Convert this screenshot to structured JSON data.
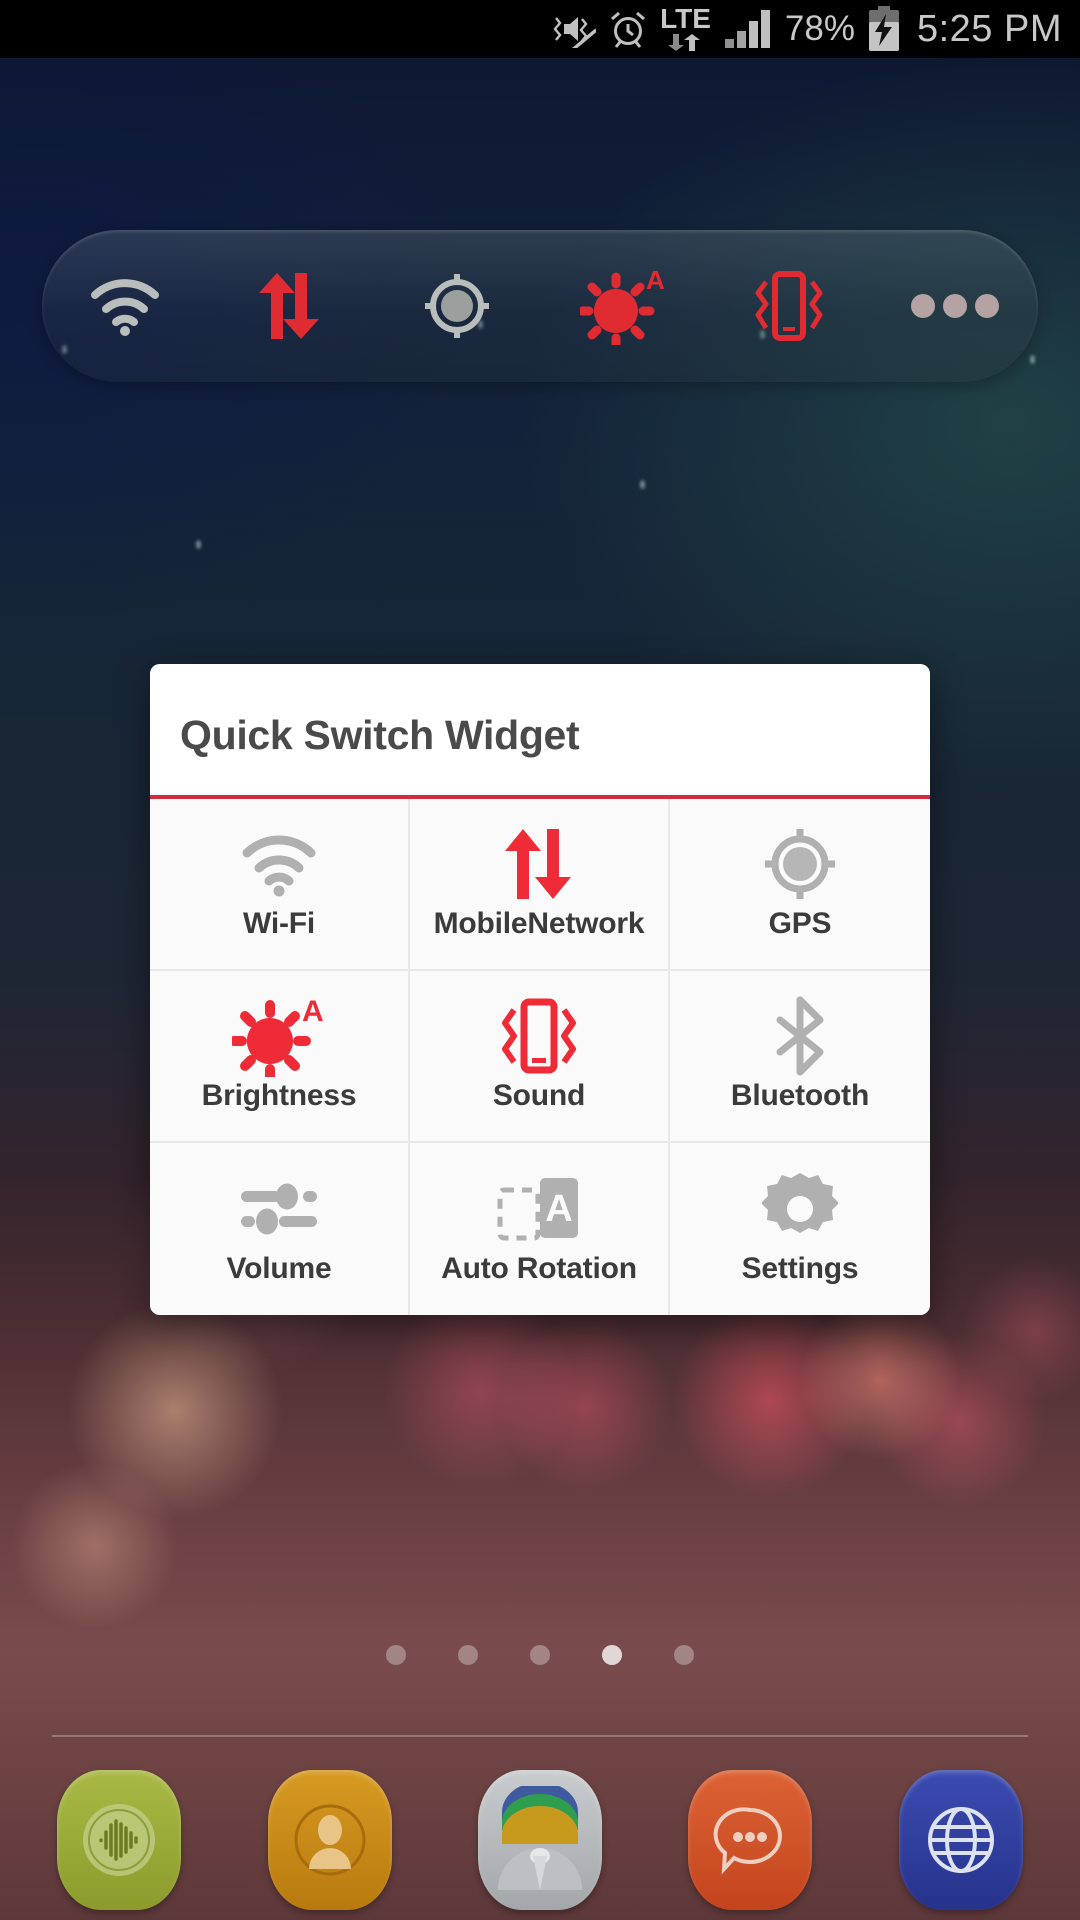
{
  "status_bar": {
    "time": "5:25 PM",
    "battery_percent": "78%",
    "network_type": "LTE",
    "icons": [
      "vibrate-mute-icon",
      "alarm-clock-icon",
      "lte-data-icon",
      "signal-bars-icon",
      "battery-charging-icon"
    ]
  },
  "floating_toolbar": {
    "items": [
      {
        "name": "wifi",
        "icon": "wifi-icon",
        "state": "off",
        "color": "#b9bdbc"
      },
      {
        "name": "mobile-network",
        "icon": "data-arrows-icon",
        "state": "on",
        "color": "#e02b33"
      },
      {
        "name": "gps",
        "icon": "gps-crosshair-icon",
        "state": "off",
        "color": "#b9bdbc"
      },
      {
        "name": "brightness",
        "icon": "brightness-auto-icon",
        "state": "on",
        "color": "#e02b33"
      },
      {
        "name": "sound",
        "icon": "vibrate-phone-icon",
        "state": "on",
        "color": "#e02b33"
      },
      {
        "name": "more",
        "icon": "more-dots-icon",
        "state": "off",
        "color": "#b9a5a5"
      }
    ]
  },
  "dialog": {
    "title": "Quick Switch Widget",
    "accent_color": "#d32b3c",
    "inactive_color": "#b0b0b0",
    "tiles": [
      {
        "label": "Wi-Fi",
        "icon": "wifi-icon",
        "state": "off",
        "color": "#b0b0b0"
      },
      {
        "label": "MobileNetwork",
        "icon": "data-arrows-icon",
        "state": "on",
        "color": "#ef2b38"
      },
      {
        "label": "GPS",
        "icon": "gps-crosshair-icon",
        "state": "off",
        "color": "#b0b0b0"
      },
      {
        "label": "Brightness",
        "icon": "brightness-auto-icon",
        "state": "on",
        "color": "#ef2b38"
      },
      {
        "label": "Sound",
        "icon": "vibrate-phone-icon",
        "state": "on",
        "color": "#ef2b38"
      },
      {
        "label": "Bluetooth",
        "icon": "bluetooth-icon",
        "state": "off",
        "color": "#b0b0b0"
      },
      {
        "label": "Volume",
        "icon": "volume-sliders-icon",
        "state": "off",
        "color": "#b0b0b0"
      },
      {
        "label": "Auto Rotation",
        "icon": "auto-rotation-icon",
        "state": "off",
        "color": "#b0b0b0"
      },
      {
        "label": "Settings",
        "icon": "gear-icon",
        "state": "off",
        "color": "#b0b0b0"
      }
    ]
  },
  "home_screen": {
    "page_dots": {
      "count": 5,
      "active_index": 3
    },
    "dock": [
      {
        "name": "phone-dialer",
        "icon": "soundwave-icon",
        "color": "#9aab3c"
      },
      {
        "name": "contacts",
        "icon": "person-icon",
        "color": "#c98a18"
      },
      {
        "name": "apps-drawer",
        "icon": "apps-icon",
        "color": "#b9bcbd"
      },
      {
        "name": "messaging",
        "icon": "chat-bubble-icon",
        "color": "#d0552a"
      },
      {
        "name": "browser",
        "icon": "globe-icon",
        "color": "#2f3e9e"
      }
    ]
  }
}
